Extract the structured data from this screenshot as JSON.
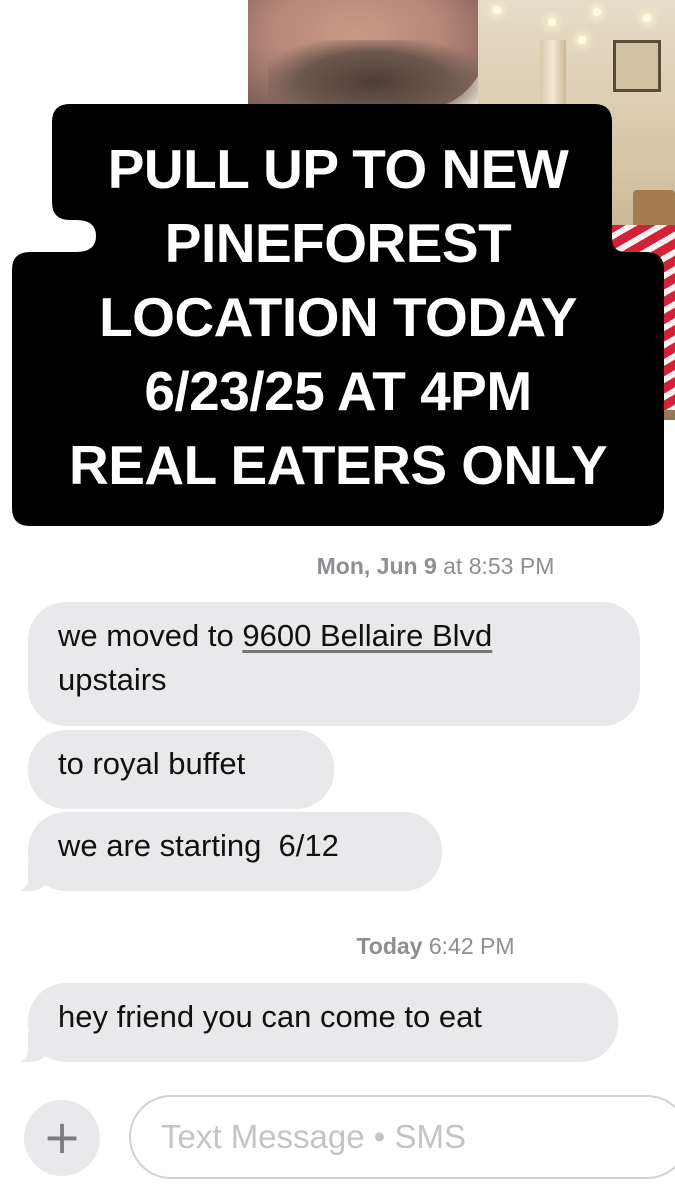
{
  "story_banner": {
    "lines": [
      "PULL UP TO NEW",
      "PINEFOREST",
      "LOCATION TODAY",
      "6/23/25 AT 4PM",
      "REAL EATERS ONLY"
    ]
  },
  "conversation": {
    "groups": [
      {
        "timestamp_day": "Mon, Jun 9",
        "timestamp_time": "at 8:53 PM",
        "messages": [
          {
            "text_before": "we moved to ",
            "link_text": "9600 Bellaire Blvd",
            "text_after": "upstairs"
          },
          {
            "text": "to royal buffet"
          },
          {
            "text": "we are starting  6/12"
          }
        ]
      },
      {
        "timestamp_day": "Today",
        "timestamp_time": "6:42 PM",
        "messages": [
          {
            "text": "hey friend you can come to eat"
          }
        ]
      }
    ]
  },
  "input_bar": {
    "plus_label": "+",
    "placeholder": "Text Message • SMS"
  },
  "colors": {
    "incoming_bubble": "#e9e9eb",
    "timestamp": "#8e8e93",
    "banner": "#000000"
  },
  "icons": {
    "plus": "plus-icon"
  }
}
